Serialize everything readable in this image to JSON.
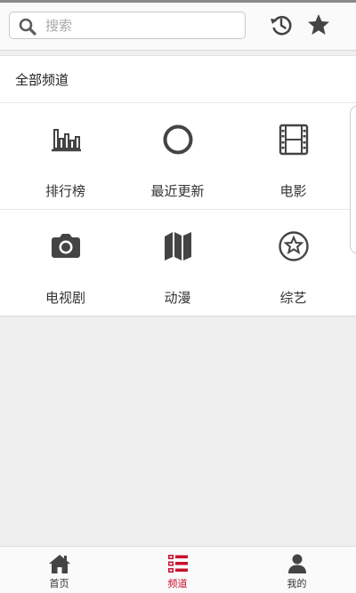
{
  "search": {
    "placeholder": "搜索"
  },
  "panel": {
    "title": "全部频道"
  },
  "channels": [
    {
      "label": "排行榜",
      "icon": "bar-chart-icon"
    },
    {
      "label": "最近更新",
      "icon": "circle-icon"
    },
    {
      "label": "电影",
      "icon": "film-icon"
    },
    {
      "label": "电视剧",
      "icon": "camera-icon"
    },
    {
      "label": "动漫",
      "icon": "map-icon"
    },
    {
      "label": "综艺",
      "icon": "star-circle-icon"
    }
  ],
  "tabs": [
    {
      "label": "首页",
      "icon": "home-icon"
    },
    {
      "label": "频道",
      "icon": "list-icon",
      "active": true
    },
    {
      "label": "我的",
      "icon": "user-icon"
    }
  ],
  "colors": {
    "accent": "#c8102e",
    "icon": "#444444",
    "background": "#efefef"
  }
}
